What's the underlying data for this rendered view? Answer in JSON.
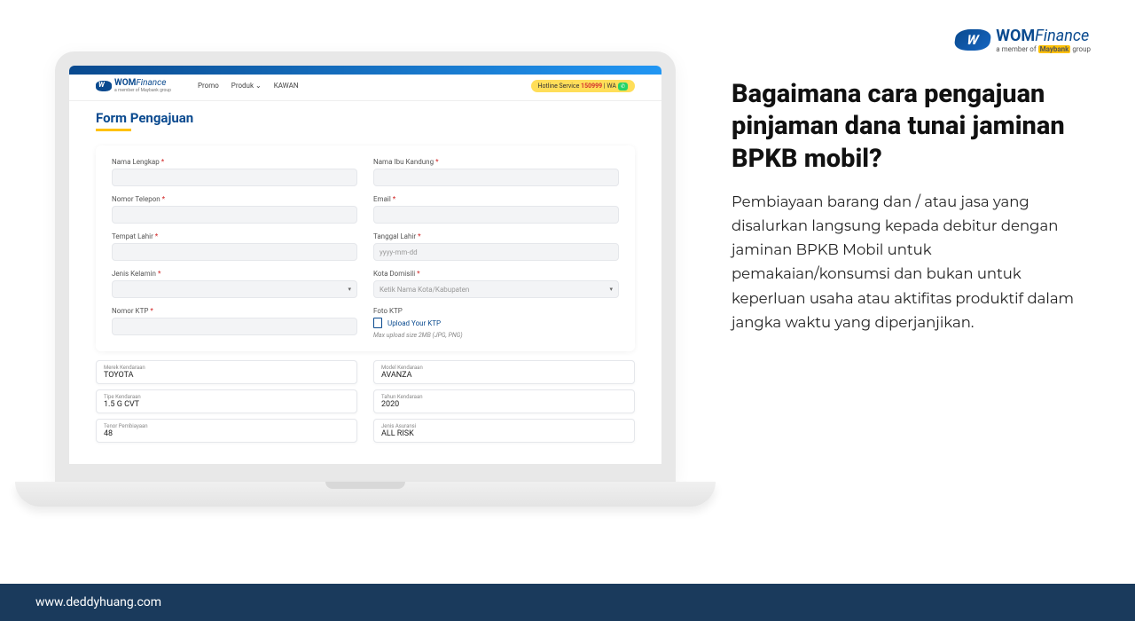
{
  "logo": {
    "brand_wom": "WOM",
    "brand_fin": "Finance",
    "tagline_pre": "a member of ",
    "tagline_hl": "Maybank",
    "tagline_post": " group"
  },
  "article": {
    "title": "Bagaimana cara pengajuan pinjaman dana tunai jaminan BPKB mobil?",
    "body": "Pembiayaan barang dan / atau jasa yang disalurkan langsung kepada debitur dengan jaminan BPKB Mobil untuk pemakaian/konsumsi dan bukan untuk keperluan usaha atau aktifitas produktif dalam jangka waktu yang diperjanjikan."
  },
  "app": {
    "nav": {
      "items": [
        "Promo",
        "Produk ⌄",
        "KAWAN"
      ],
      "hotline_label": "Hotline Service ",
      "hotline_num": "150999",
      "hotline_sep": " | WA"
    },
    "form_title": "Form Pengajuan",
    "fields": {
      "nama_lengkap": "Nama Lengkap",
      "nama_ibu": "Nama Ibu Kandung",
      "telepon": "Nomor Telepon",
      "email": "Email",
      "tempat_lahir": "Tempat Lahir",
      "tanggal_lahir": "Tanggal Lahir",
      "tanggal_ph": "yyyy-mm-dd",
      "jenis_kelamin": "Jenis Kelamin",
      "kota": "Kota Domisili",
      "kota_ph": "Ketik Nama Kota/Kabupaten",
      "ktp": "Nomor KTP",
      "foto_ktp": "Foto KTP",
      "upload": "Upload Your KTP",
      "upload_hint": "Max upload size 2MB (JPG, PNG)"
    },
    "filled": [
      {
        "label": "Merek Kendaraan",
        "value": "TOYOTA"
      },
      {
        "label": "Model Kendaraan",
        "value": "AVANZA"
      },
      {
        "label": "Tipe Kendaraan",
        "value": "1.5 G CVT"
      },
      {
        "label": "Tahun Kendaraan",
        "value": "2020"
      },
      {
        "label": "Tenor Pembiayaan",
        "value": "48"
      },
      {
        "label": "Jenis Asuransi",
        "value": "ALL RISK"
      }
    ]
  },
  "footer": {
    "url": "www.deddyhuang.com"
  }
}
